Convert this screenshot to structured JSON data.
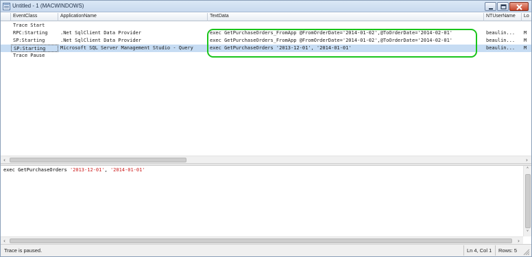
{
  "window": {
    "title": "Untitled - 1 (MACWINDOWS)"
  },
  "grid": {
    "columns": [
      "EventClass",
      "ApplicationName",
      "TextData",
      "NTUserName",
      "Lo"
    ],
    "rows": [
      {
        "event_class": "Trace Start",
        "application_name": "",
        "text_data": "",
        "nt_user_name": "",
        "login": ""
      },
      {
        "event_class": "RPC:Starting",
        "application_name": ".Net SqlClient Data Provider",
        "text_data": "exec GetPurchaseOrders_FromApp @FromOrderDate='2014-01-02',@ToOrderDate='2014-02-01'",
        "nt_user_name": "beaulin...",
        "login": "M"
      },
      {
        "event_class": "SP:Starting",
        "application_name": ".Net SqlClient Data Provider",
        "text_data": "exec GetPurchaseOrders_FromApp @FromOrderDate='2014-01-02',@ToOrderDate='2014-02-01'",
        "nt_user_name": "beaulin...",
        "login": "M"
      },
      {
        "event_class": "SP:Starting",
        "application_name": "Microsoft SQL Server Management Studio - Query",
        "text_data": "exec GetPurchaseOrders '2013-12-01', '2014-01-01'",
        "nt_user_name": "beaulin...",
        "login": "M"
      },
      {
        "event_class": "Trace Pause",
        "application_name": "",
        "text_data": "",
        "nt_user_name": "",
        "login": ""
      }
    ],
    "selected_row": 3
  },
  "detail": {
    "keyword": "exec GetPurchaseOrders ",
    "arg1": "'2013-12-01'",
    "sep": ", ",
    "arg2": "'2014-01-01'"
  },
  "status": {
    "message": "Trace is paused.",
    "position": "Ln 4, Col 1",
    "rows": "Rows: 5"
  },
  "colors": {
    "highlight": "#19c41a",
    "selection": "#c6dcf3",
    "string_literal": "#cc1a1a"
  }
}
